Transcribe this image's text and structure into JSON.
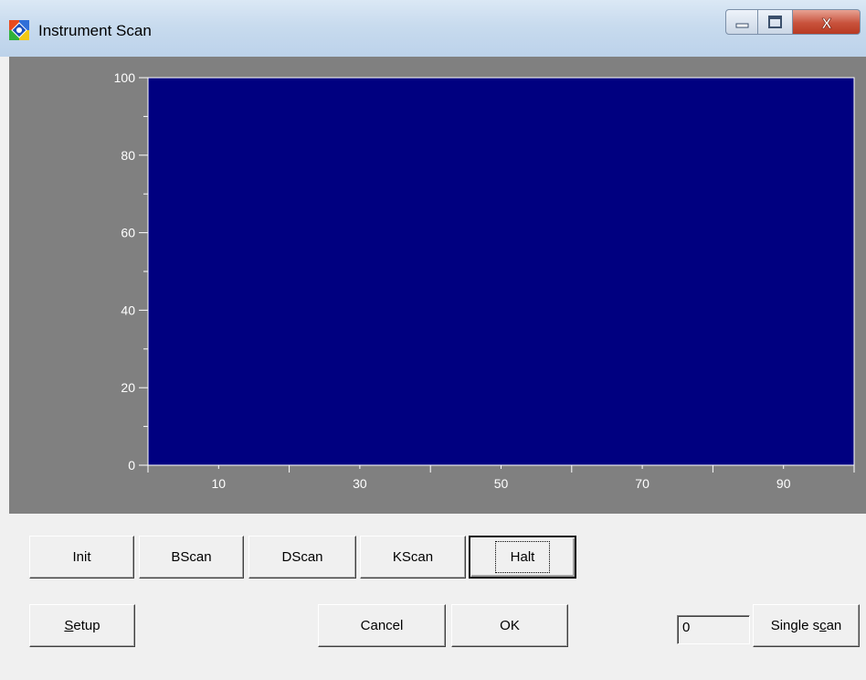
{
  "window": {
    "title": "Instrument Scan",
    "close_glyph": "X"
  },
  "icons": {
    "app": "app-logo-icon",
    "minimize": "minimize-icon",
    "maximize": "maximize-icon",
    "close": "close-icon"
  },
  "chart_data": {
    "type": "line",
    "background_color": "#000080",
    "frame_color": "#808080",
    "xlim": [
      0,
      100
    ],
    "ylim": [
      0,
      100
    ],
    "x_ticks": [
      10,
      30,
      50,
      70,
      90
    ],
    "y_ticks": [
      0,
      20,
      40,
      60,
      80,
      100
    ],
    "series": []
  },
  "buttons": {
    "init": "Init",
    "bscan": "BScan",
    "dscan": "DScan",
    "kscan": "KScan",
    "halt": "Halt",
    "setup_mnemonic": "S",
    "setup_rest": "etup",
    "cancel": "Cancel",
    "ok": "OK",
    "single_scan_pre": "Single s",
    "single_scan_mnemonic": "c",
    "single_scan_post": "an"
  },
  "scan_count": "0"
}
